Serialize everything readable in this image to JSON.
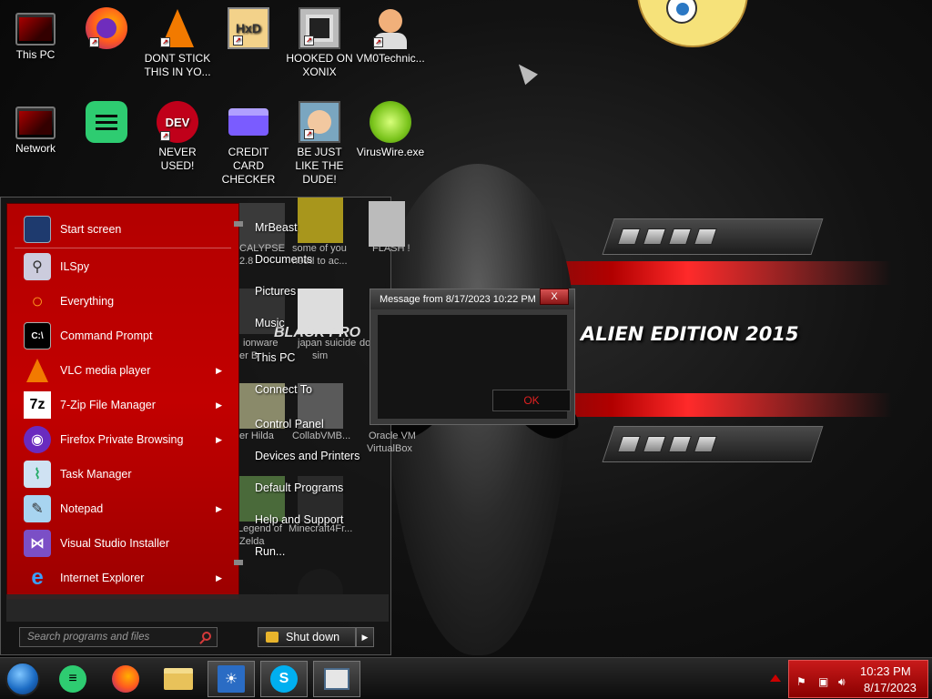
{
  "wallpaper": {
    "title": "ALIEN EDITION 2015"
  },
  "desktop_icons": [
    {
      "label": "This PC",
      "icon": "monitor-icon"
    },
    {
      "label": "",
      "icon": "firefox-icon"
    },
    {
      "label": "DONT STICK THIS IN YO...",
      "icon": "vlc-cone-icon"
    },
    {
      "label": "",
      "icon": "hex-editor-icon"
    },
    {
      "label": "HOOKED ON XONIX",
      "icon": "xonix-game-icon"
    },
    {
      "label": "VM0Technic...",
      "icon": "avatar-icon"
    },
    {
      "label": "Network",
      "icon": "network-monitor-icon"
    },
    {
      "label": "",
      "icon": "green-chat-icon"
    },
    {
      "label": "NEVER USED!",
      "icon": "dev-cpp-icon"
    },
    {
      "label": "CREDIT CARD CHECKER",
      "icon": "credit-card-icon"
    },
    {
      "label": "BE JUST LIKE THE DUDE!",
      "icon": "elf-icon"
    },
    {
      "label": "VirusWire.exe",
      "icon": "lime-icon"
    }
  ],
  "start_menu": {
    "items": [
      {
        "label": "Start screen",
        "icon": "start-screen-icon",
        "has_submenu": false
      },
      {
        "label": "ILSpy",
        "icon": "ilspy-icon",
        "has_submenu": false
      },
      {
        "label": "Everything",
        "icon": "magnifier-icon",
        "has_submenu": false
      },
      {
        "label": "Command Prompt",
        "icon": "terminal-icon",
        "has_submenu": false
      },
      {
        "label": "VLC media player",
        "icon": "vlc-icon",
        "has_submenu": true
      },
      {
        "label": "7-Zip File Manager",
        "icon": "7zip-icon",
        "has_submenu": true
      },
      {
        "label": "Firefox Private Browsing",
        "icon": "firefox-private-icon",
        "has_submenu": true
      },
      {
        "label": "Task Manager",
        "icon": "task-manager-icon",
        "has_submenu": false
      },
      {
        "label": "Notepad",
        "icon": "notepad-icon",
        "has_submenu": true
      },
      {
        "label": "Visual Studio Installer",
        "icon": "visual-studio-icon",
        "has_submenu": false
      },
      {
        "label": "Internet Explorer",
        "icon": "internet-explorer-icon",
        "has_submenu": true
      }
    ],
    "right_links": [
      "MrBeast",
      "Documents",
      "Pictures",
      "Music",
      "This PC",
      "Connect To",
      "Control Panel",
      "Devices and Printers",
      "Default Programs",
      "Help and Support",
      "Run..."
    ],
    "background_labels": [
      "CALYPSE",
      "2.8",
      "some of you",
      "need to ac...",
      "FLASH !",
      "BLACK PRO",
      "ionware",
      "er B",
      "japan suicide",
      "sim",
      "do",
      "er Hilda",
      "CollabVMB...",
      "Oracle VM",
      "VirtualBox",
      "Legend of",
      "Zelda",
      "Minecraft4Fr..."
    ],
    "search_placeholder": "Search programs and files",
    "shutdown_label": "Shut down"
  },
  "message_box": {
    "title": "Message from  8/17/2023 10:22 PM",
    "close_label": "X",
    "message": "",
    "ok_label": "OK"
  },
  "taskbar": {
    "pinned": [
      {
        "name": "green-chat-icon",
        "active": false
      },
      {
        "name": "firefox-icon",
        "active": false
      },
      {
        "name": "file-explorer-icon",
        "active": false
      },
      {
        "name": "sun-app-icon",
        "active": true
      },
      {
        "name": "skype-icon",
        "active": true
      },
      {
        "name": "window-app-icon",
        "active": true
      }
    ],
    "clock_time": "10:23 PM",
    "clock_date": "8/17/2023"
  },
  "colors": {
    "accent_red": "#c20000",
    "message_red": "#e02020",
    "tray_red": "#c81a1a"
  }
}
